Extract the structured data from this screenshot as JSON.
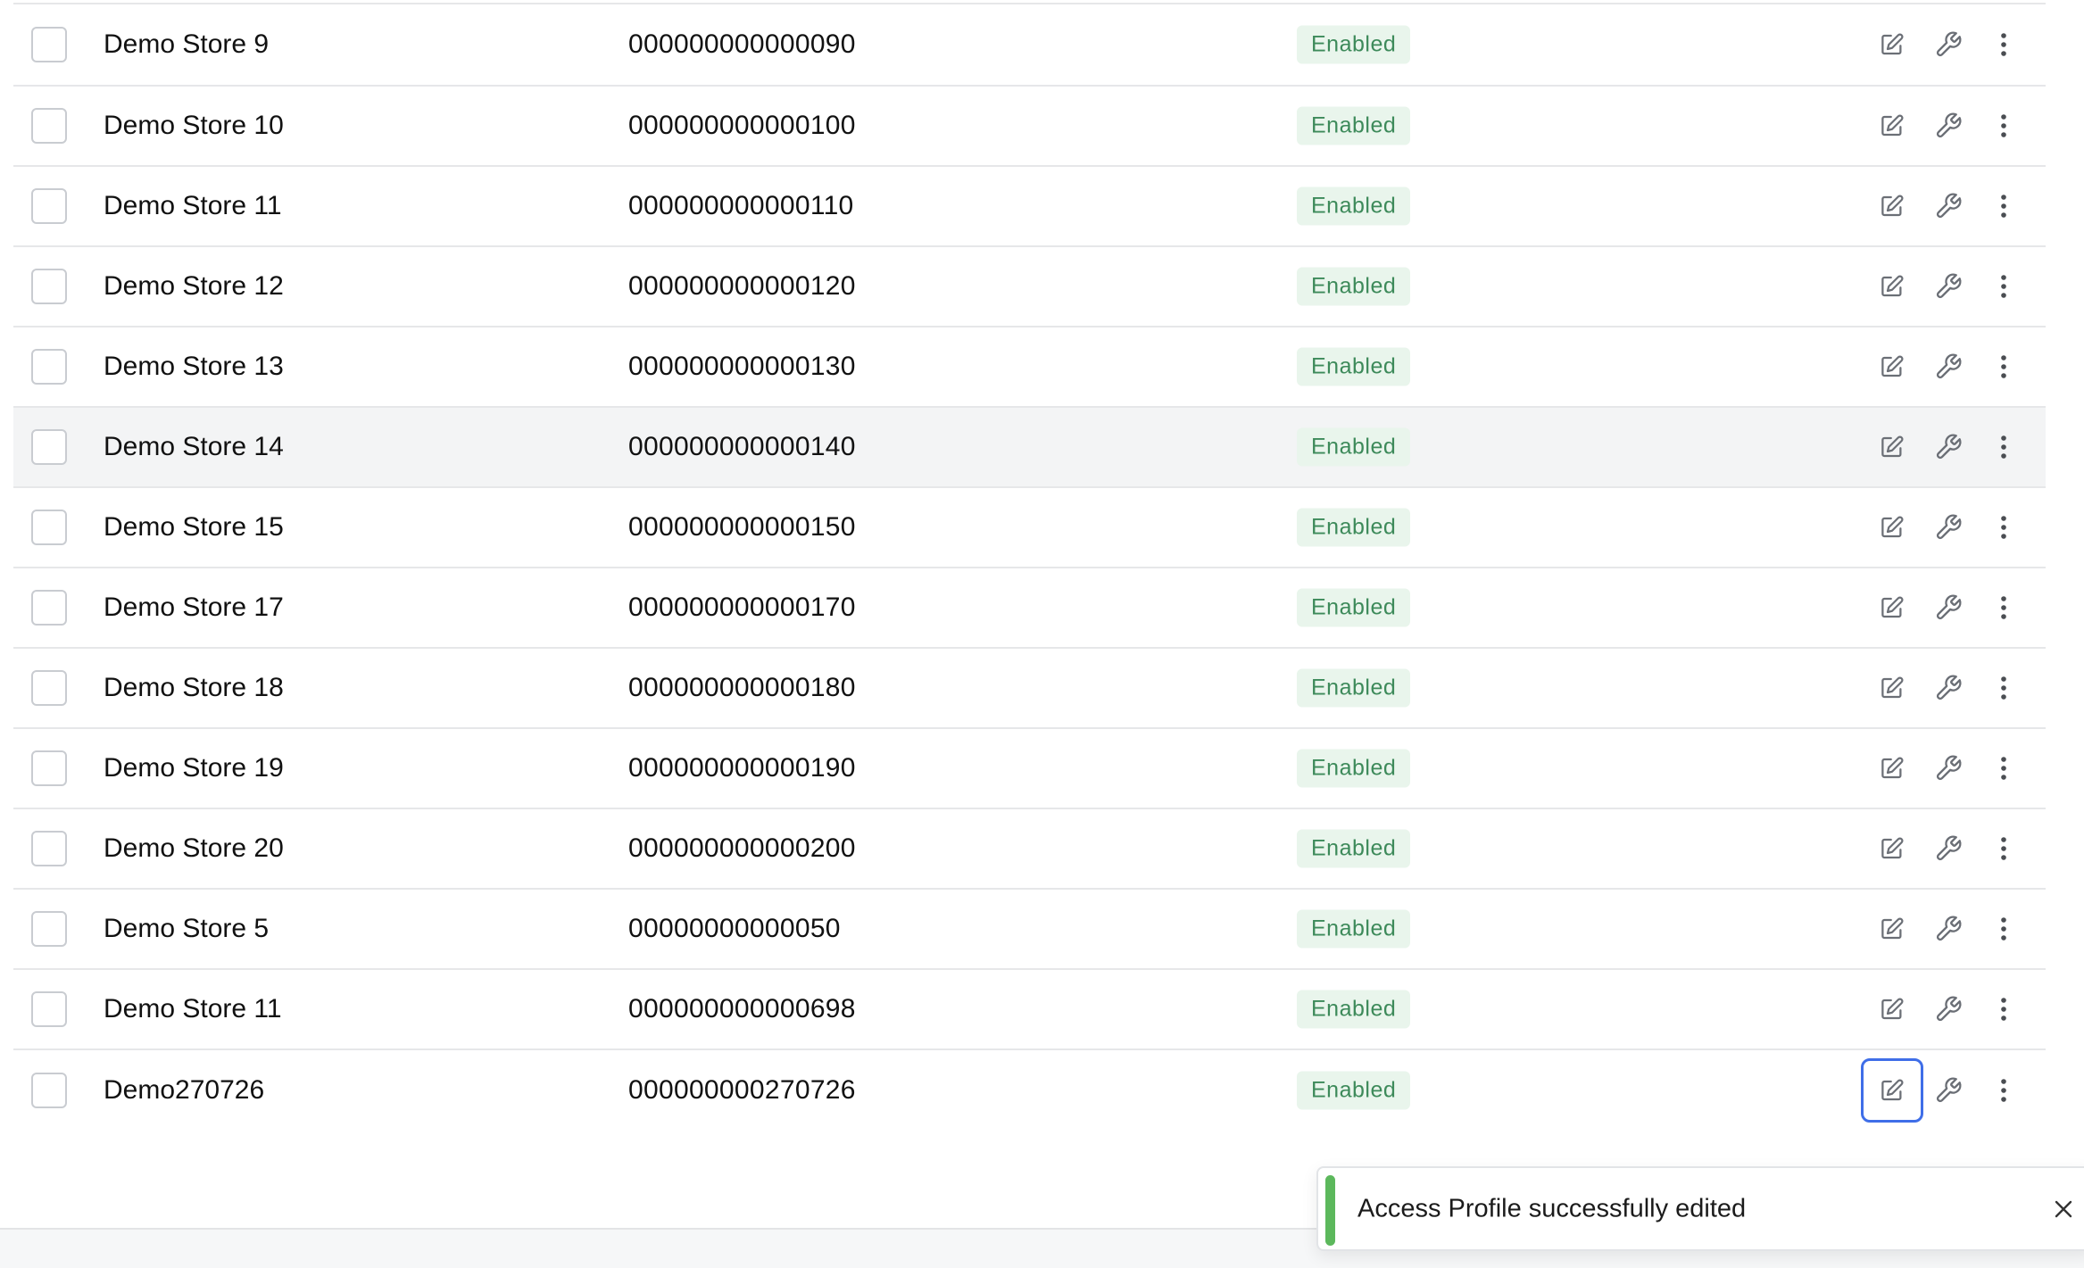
{
  "rows": [
    {
      "name": "Demo Store 9",
      "code": "000000000000090",
      "status": "Enabled"
    },
    {
      "name": "Demo Store 10",
      "code": "000000000000100",
      "status": "Enabled"
    },
    {
      "name": "Demo Store 11",
      "code": "000000000000110",
      "status": "Enabled"
    },
    {
      "name": "Demo Store 12",
      "code": "000000000000120",
      "status": "Enabled"
    },
    {
      "name": "Demo Store 13",
      "code": "000000000000130",
      "status": "Enabled"
    },
    {
      "name": "Demo Store 14",
      "code": "000000000000140",
      "status": "Enabled"
    },
    {
      "name": "Demo Store 15",
      "code": "000000000000150",
      "status": "Enabled"
    },
    {
      "name": "Demo Store 17",
      "code": "000000000000170",
      "status": "Enabled"
    },
    {
      "name": "Demo Store 18",
      "code": "000000000000180",
      "status": "Enabled"
    },
    {
      "name": "Demo Store 19",
      "code": "000000000000190",
      "status": "Enabled"
    },
    {
      "name": "Demo Store 20",
      "code": "000000000000200",
      "status": "Enabled"
    },
    {
      "name": "Demo Store 5",
      "code": "00000000000050",
      "status": "Enabled"
    },
    {
      "name": "Demo Store 11",
      "code": "000000000000698",
      "status": "Enabled"
    },
    {
      "name": "Demo270726",
      "code": "000000000270726",
      "status": "Enabled"
    }
  ],
  "row_icons": [
    "edit-icon",
    "wrench-icon",
    "more-vertical-icon"
  ],
  "toast": {
    "message": "Access Profile successfully edited",
    "close_icon": "close-icon",
    "accent_color": "#5cb85c"
  },
  "colors": {
    "badge_bg": "#e9f5ec",
    "badge_text": "#3d8a5a",
    "focus": "#3f6ee8",
    "hover_row": "#f3f4f5"
  }
}
